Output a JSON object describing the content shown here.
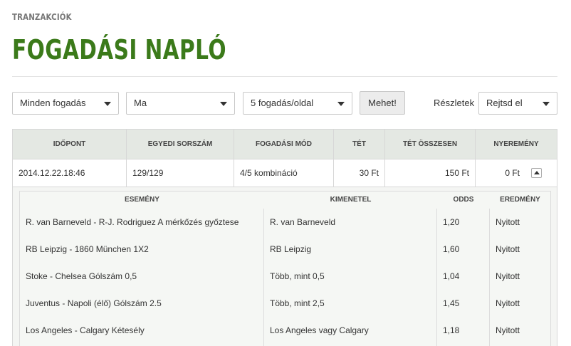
{
  "breadcrumb": "TRANZAKCIÓK",
  "title": "FOGADÁSI NAPLÓ",
  "filters": {
    "bet_type": "Minden fogadás",
    "period": "Ma",
    "per_page": "5 fogadás/oldal",
    "go_button": "Mehet!",
    "details_label": "Részletek",
    "details_value": "Rejtsd el"
  },
  "table": {
    "headers": [
      "IDŐPONT",
      "EGYEDI SORSZÁM",
      "FOGADÁSI MÓD",
      "TÉT",
      "TÉT ÖSSZESEN",
      "NYEREMÉNY"
    ],
    "row": {
      "time": "2014.12.22.18:46",
      "serial": "129/129",
      "mode": "4/5 kombináció",
      "stake": "30 Ft",
      "total_stake": "150 Ft",
      "winnings": "0 Ft"
    }
  },
  "details": {
    "headers": [
      "ESEMÉNY",
      "KIMENETEL",
      "ODDS",
      "EREDMÉNY"
    ],
    "rows": [
      {
        "event": "R. van Barneveld - R-J. Rodriguez A mérkőzés győztese",
        "outcome": "R. van Barneveld",
        "odds": "1,20",
        "result": "Nyitott"
      },
      {
        "event": "RB Leipzig - 1860 München 1X2",
        "outcome": "RB Leipzig",
        "odds": "1,60",
        "result": "Nyitott"
      },
      {
        "event": "Stoke - Chelsea Gólszám 0,5",
        "outcome": "Több, mint 0,5",
        "odds": "1,04",
        "result": "Nyitott"
      },
      {
        "event": "Juventus - Napoli (élő) Gólszám 2.5",
        "outcome": "Több, mint 2,5",
        "odds": "1,45",
        "result": "Nyitott"
      },
      {
        "event": "Los Angeles - Calgary Kétesély",
        "outcome": "Los Angeles vagy Calgary",
        "odds": "1,18",
        "result": "Nyitott"
      }
    ]
  },
  "colors": {
    "title_green": "#3b7a1a",
    "header_bg": "#e4e8e3"
  }
}
